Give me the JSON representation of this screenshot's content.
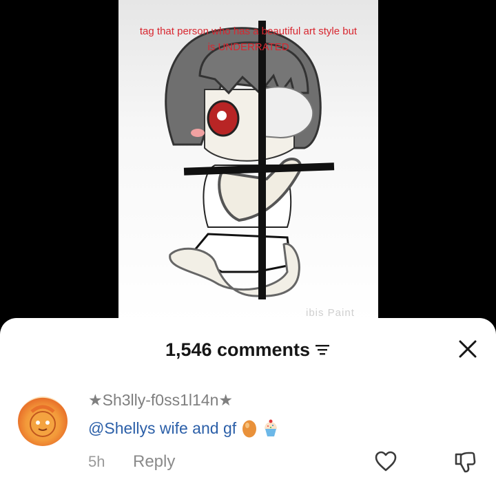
{
  "video": {
    "caption_line1": "tag that  person who has a beautiful art style but",
    "caption_line2": "is UNDERRATED",
    "watermark": "ibis Paint"
  },
  "comments_sheet": {
    "count_label": "1,546 comments",
    "comment": {
      "username": "★Sh3lly-f0ss1l14n★",
      "text": "@Shellys wife and gf",
      "emojis": [
        "egg",
        "cupcake"
      ],
      "time": "5h",
      "reply_label": "Reply"
    }
  },
  "icons": [
    "sort-icon",
    "close-icon",
    "heart-icon",
    "dislike-icon"
  ],
  "colors": {
    "caption": "#d8262f",
    "mention": "#2b5fa8",
    "muted": "#8a8a8a"
  }
}
